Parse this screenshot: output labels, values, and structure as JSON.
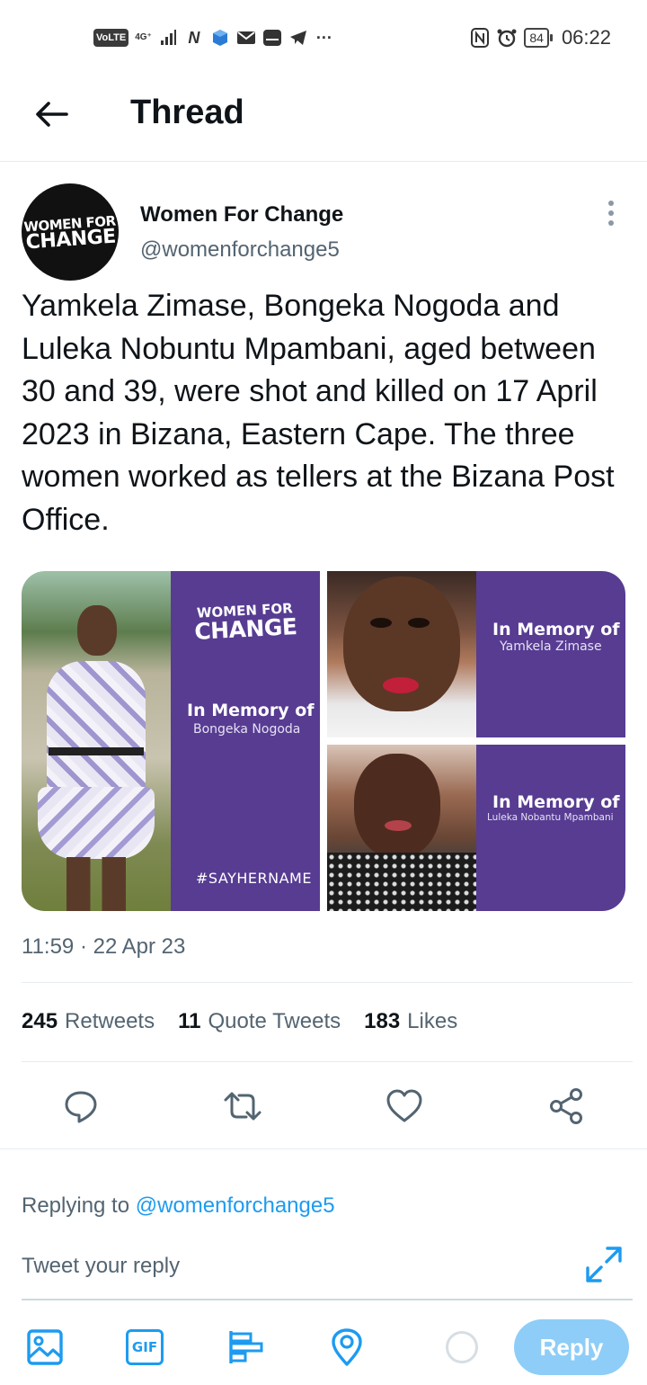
{
  "status_bar": {
    "volte": "VoLTE",
    "network": "4G⁺",
    "battery": "84",
    "time": "06:22",
    "icons": [
      "nfc-icon",
      "alarm-icon",
      "telegram-icon",
      "mail-icon",
      "more-dots-icon"
    ]
  },
  "header": {
    "title": "Thread"
  },
  "tweet": {
    "avatar_text_small": "WOMEN FOR",
    "avatar_text_big": "CHANGE",
    "author_name": "Women For Change",
    "author_handle": "@womenforchange5",
    "text": "Yamkela Zimase, Bongeka Nogoda and Luleka Nobuntu Mpambani, aged between 30 and 39, were shot and killed on 17 April 2023 in Bizana, Eastern Cape. The three women worked as tellers at the Bizana Post Office.",
    "media": {
      "logo_small": "WOMEN FOR",
      "logo_big": "CHANGE",
      "tiles": [
        {
          "title": "In Memory of",
          "name": "Bongeka Nogoda",
          "hashtag": "#SAYHERNAME"
        },
        {
          "title": "In Memory of",
          "name": "Yamkela Zimase"
        },
        {
          "title": "In Memory of",
          "name": "Luleka Nobantu Mpambani"
        }
      ]
    },
    "timestamp": "11:59 · 22 Apr 23",
    "stats": {
      "retweets_count": "245",
      "retweets_label": "Retweets",
      "quotes_count": "11",
      "quotes_label": "Quote Tweets",
      "likes_count": "183",
      "likes_label": "Likes"
    }
  },
  "reply": {
    "replying_prefix": "Replying to",
    "replying_handle": "@womenforchange5",
    "placeholder": "Tweet your reply",
    "button_label": "Reply",
    "gif_label": "GIF"
  },
  "colors": {
    "accent": "#1d9bf0",
    "reply_button_disabled": "#8ecdf7",
    "memorial_purple": "#573c92",
    "secondary_text": "#536471"
  }
}
